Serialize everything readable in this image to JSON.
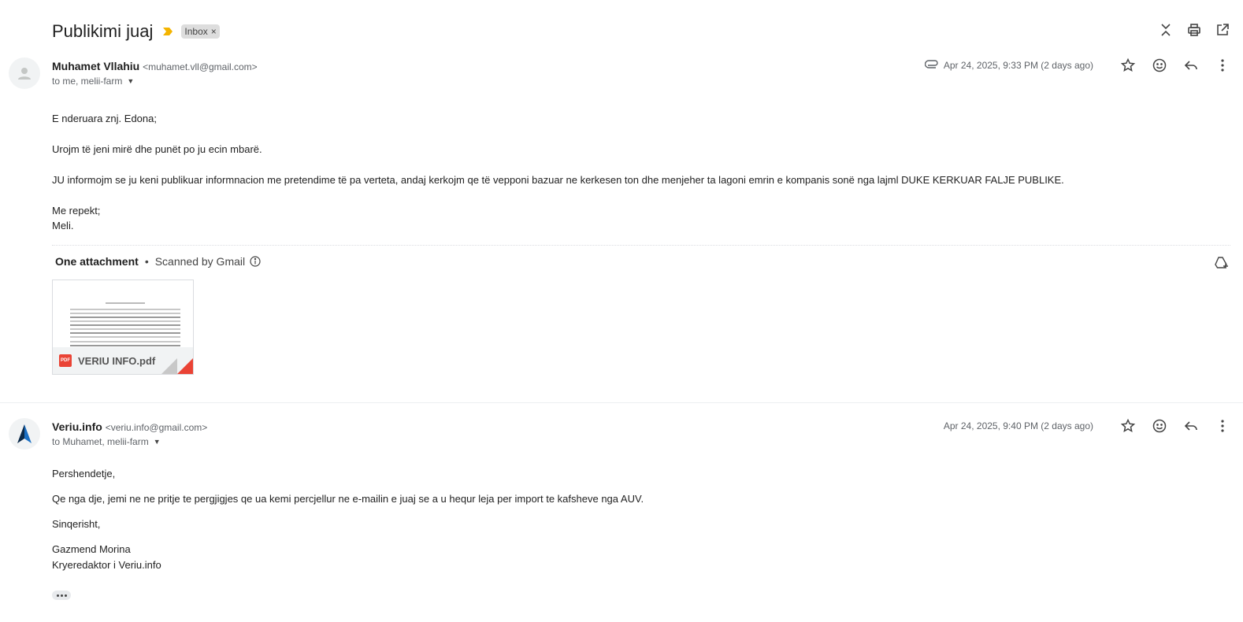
{
  "thread": {
    "subject": "Publikimi juaj",
    "label": "Inbox",
    "label_remove": "×",
    "icons": [
      "expand-collapse-icon",
      "print-icon",
      "open-new-window-icon"
    ]
  },
  "message1": {
    "sender_name": "Muhamet Vllahiu",
    "sender_email": "<muhamet.vll@gmail.com>",
    "to": "to me, melii-farm",
    "date": "Apr 24, 2025, 9:33 PM (2 days ago)",
    "has_attachment": true,
    "body": [
      "E nderuara znj. Edona;",
      "Urojm të jeni mirë dhe punët po ju ecin mbarë.",
      "JU informojm se ju keni publikuar informnacion me pretendime të pa verteta, andaj  kerkojm qe të vepроni bazuar ne kerkesen ton dhe menjeher ta lagoni emrin e kompanis sonë nga lajml DUKE KERKUAR FALJE PUBLIKE.",
      "Me repekt;",
      "Meli."
    ]
  },
  "attachments": {
    "title": "One attachment",
    "separator": "•",
    "scanned": "Scanned by Gmail",
    "files": [
      {
        "name": "VERIU INFO.pdf",
        "type_badge": "PDF",
        "badge_color": "#ea4335"
      }
    ]
  },
  "message2": {
    "sender_name": "Veriu.info",
    "sender_email": "<veriu.info@gmail.com>",
    "to": "to Muhamet, melii-farm",
    "date": "Apr 24, 2025, 9:40 PM (2 days ago)",
    "body": [
      "Pershendetje,",
      "Qe nga dje, jemi ne ne pritje te pergjigjes qe ua kemi percjellur ne e-mailin e juaj se a u hequr leja per import te kafsheve nga AUV.",
      "Sinqerisht,",
      "Gazmend Morina",
      "Kryeredaktor i Veriu.info"
    ]
  },
  "colors": {
    "importance": "#f4b400",
    "accent_red": "#ea4335"
  }
}
